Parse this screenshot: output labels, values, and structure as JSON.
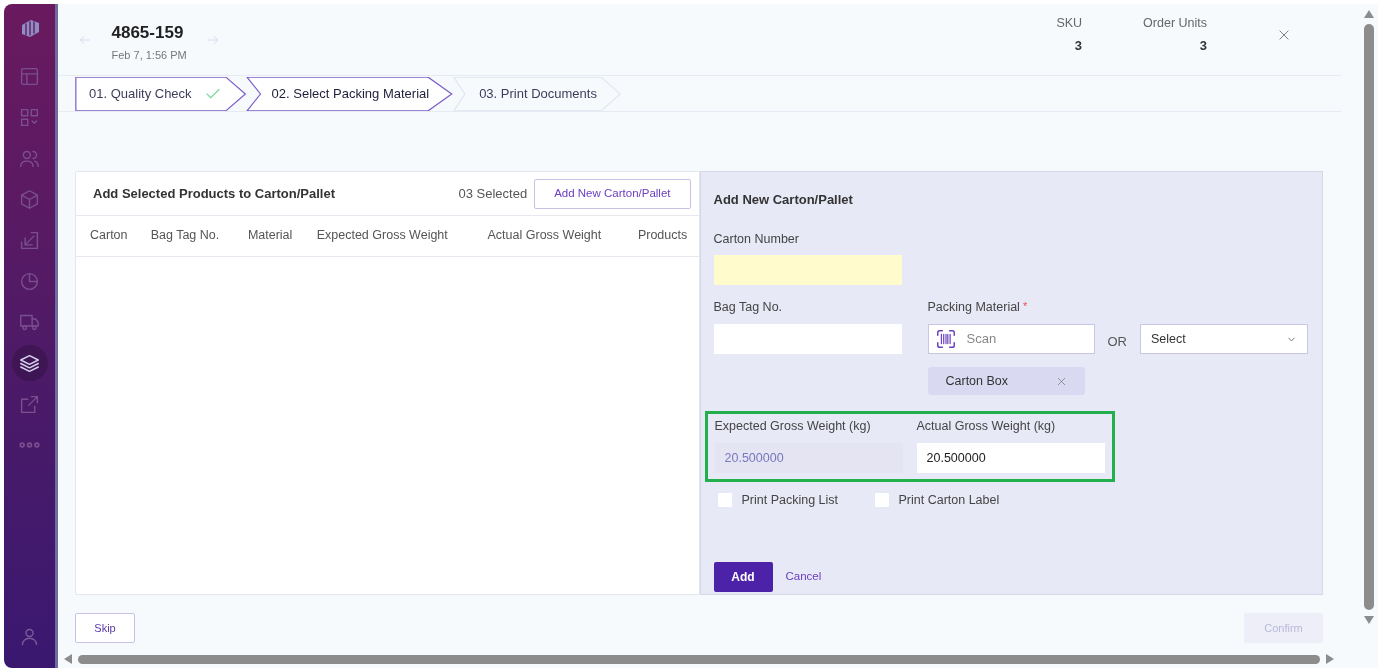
{
  "sidebar": {
    "items": [
      {
        "selected": false
      },
      {
        "selected": false
      },
      {
        "selected": false
      },
      {
        "selected": false
      },
      {
        "selected": false
      },
      {
        "selected": false
      },
      {
        "selected": false
      },
      {
        "selected": true
      },
      {
        "selected": false
      },
      {
        "selected": false
      }
    ]
  },
  "header": {
    "order_number": "4865-159",
    "date": "Feb 7, 1:56 PM",
    "stats": [
      {
        "label": "SKU",
        "value": "3"
      },
      {
        "label": "Order Units",
        "value": "3"
      }
    ]
  },
  "steps": [
    {
      "label": "01. Quality Check",
      "completed": true,
      "selected": false
    },
    {
      "label": "02. Select Packing Material",
      "completed": false,
      "selected": true
    },
    {
      "label": "03. Print Documents",
      "completed": false,
      "selected": false
    }
  ],
  "products_card": {
    "title": "Add Selected Products to Carton/Pallet",
    "selected_count": "03 Selected",
    "add_button": "Add New Carton/Pallet",
    "table": {
      "columns": [
        "Carton",
        "Bag Tag No.",
        "Material",
        "Expected Gross Weight",
        "Actual Gross Weight",
        "Products"
      ]
    }
  },
  "form": {
    "title": "Add New Carton/Pallet",
    "carton_number": {
      "label": "Carton Number",
      "highlighted": true
    },
    "bag_tag": {
      "label": "Bag Tag No."
    },
    "packing_material": {
      "label": "Packing Material",
      "required_mark": "*",
      "scan_placeholder": "Scan",
      "or": "OR",
      "select": "Select",
      "chips": [
        "Carton Box"
      ]
    },
    "expected_weight": {
      "label": "Expected Gross Weight (kg)",
      "value": "20.500000",
      "disabled": true
    },
    "actual_weight": {
      "label": "Actual Gross Weight (kg)",
      "value": "20.500000",
      "disabled": false
    },
    "checkboxes": [
      {
        "label": "Print Packing List",
        "checked": false
      },
      {
        "label": "Print Carton Label",
        "checked": false
      }
    ],
    "add_button": "Add",
    "cancel_link": "Cancel"
  },
  "footer": {
    "skip_button": "Skip",
    "confirm_button": {
      "label": "Confirm",
      "disabled": true
    }
  }
}
